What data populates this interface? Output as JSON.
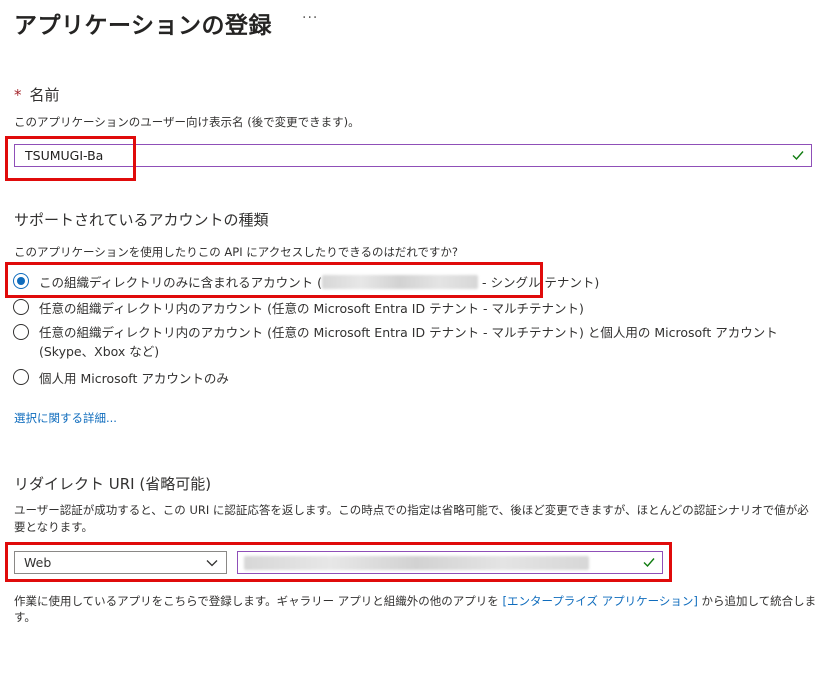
{
  "header": {
    "title": "アプリケーションの登録",
    "more": "···"
  },
  "name_section": {
    "required_mark": "*",
    "label": "名前",
    "description": "このアプリケーションのユーザー向け表示名 (後で変更できます)。",
    "value": "TSUMUGI-Ba"
  },
  "account_section": {
    "title": "サポートされているアカウントの種類",
    "question": "このアプリケーションを使用したりこの API にアクセスしたりできるのはだれですか?",
    "options": [
      {
        "label_prefix": "この組織ディレクトリのみに含まれるアカウント (",
        "label_suffix": " - シングル テナント)",
        "selected": true
      },
      {
        "label": "任意の組織ディレクトリ内のアカウント (任意の Microsoft Entra ID テナント - マルチテナント)",
        "selected": false
      },
      {
        "label": "任意の組織ディレクトリ内のアカウント (任意の Microsoft Entra ID テナント - マルチテナント) と個人用の Microsoft アカウント (Skype、Xbox など)",
        "selected": false
      },
      {
        "label": "個人用 Microsoft アカウントのみ",
        "selected": false
      }
    ],
    "detail_link": "選択に関する詳細..."
  },
  "redirect_section": {
    "title": "リダイレクト URI (省略可能)",
    "description": "ユーザー認証が成功すると、この URI に認証応答を返します。この時点での指定は省略可能で、後ほど変更できますが、ほとんどの認証シナリオで値が必要となります。",
    "platform": "Web",
    "footer_before": "作業に使用しているアプリをこちらで登録します。ギャラリー アプリと組織外の他のアプリを ",
    "footer_link": "[エンタープライズ アプリケーション]",
    "footer_after": " から追加して統合します。"
  },
  "colors": {
    "accent": "#0f6cbd",
    "highlight": "#e00b0b",
    "valid": "#107c10",
    "input_border": "#8f4fb8"
  }
}
